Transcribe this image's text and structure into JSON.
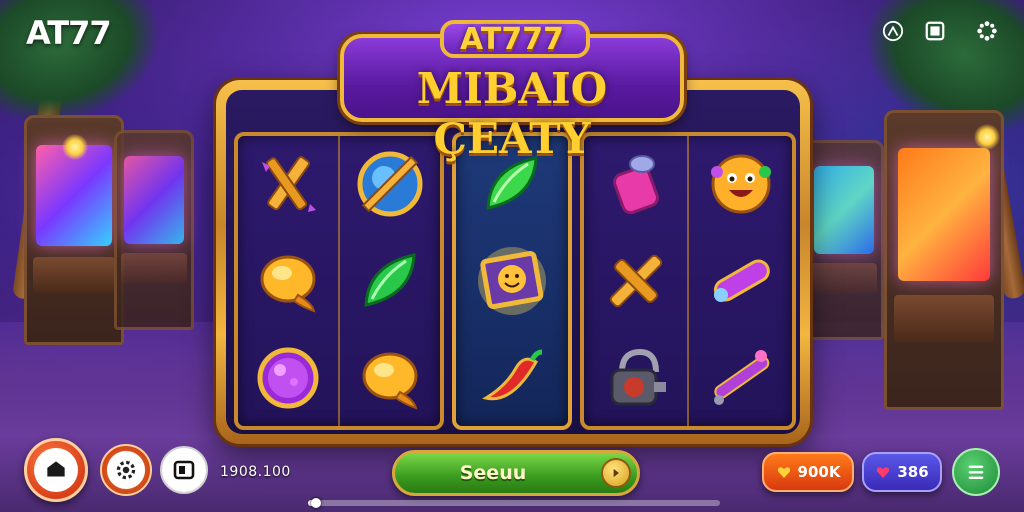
{
  "brand": {
    "logo_text": "AT77"
  },
  "title": {
    "line1": "AT777",
    "line2": "MIBAIO ÇEATY"
  },
  "top_right": {
    "icons": [
      "profile-icon",
      "window-icon",
      "settings-dots-icon"
    ]
  },
  "reels": {
    "group1": [
      [
        "sword-cross",
        "golden-bell",
        "purple-orb"
      ],
      [
        "blue-shield-orb",
        "green-leaf-gem",
        "golden-bell"
      ]
    ],
    "group2": [
      [
        "green-leaf-gem",
        "framed-smiley",
        "chili-pepper"
      ]
    ],
    "group3": [
      [
        "pink-potion-bottle",
        "golden-cross",
        "padlock-machine"
      ],
      [
        "smiley-face",
        "purple-tube",
        "purple-wand"
      ]
    ]
  },
  "bottom": {
    "balance": "1908.100",
    "spin_label": "Seeuu",
    "gems": "900K",
    "coins": "386",
    "progress": 0.02
  },
  "colors": {
    "gold": "#f0b93a",
    "purple": "#6a24b8",
    "spin_green": "#3a9a1e",
    "gems_orange": "#ff7a1a",
    "coins_blue": "#5a58e8"
  }
}
